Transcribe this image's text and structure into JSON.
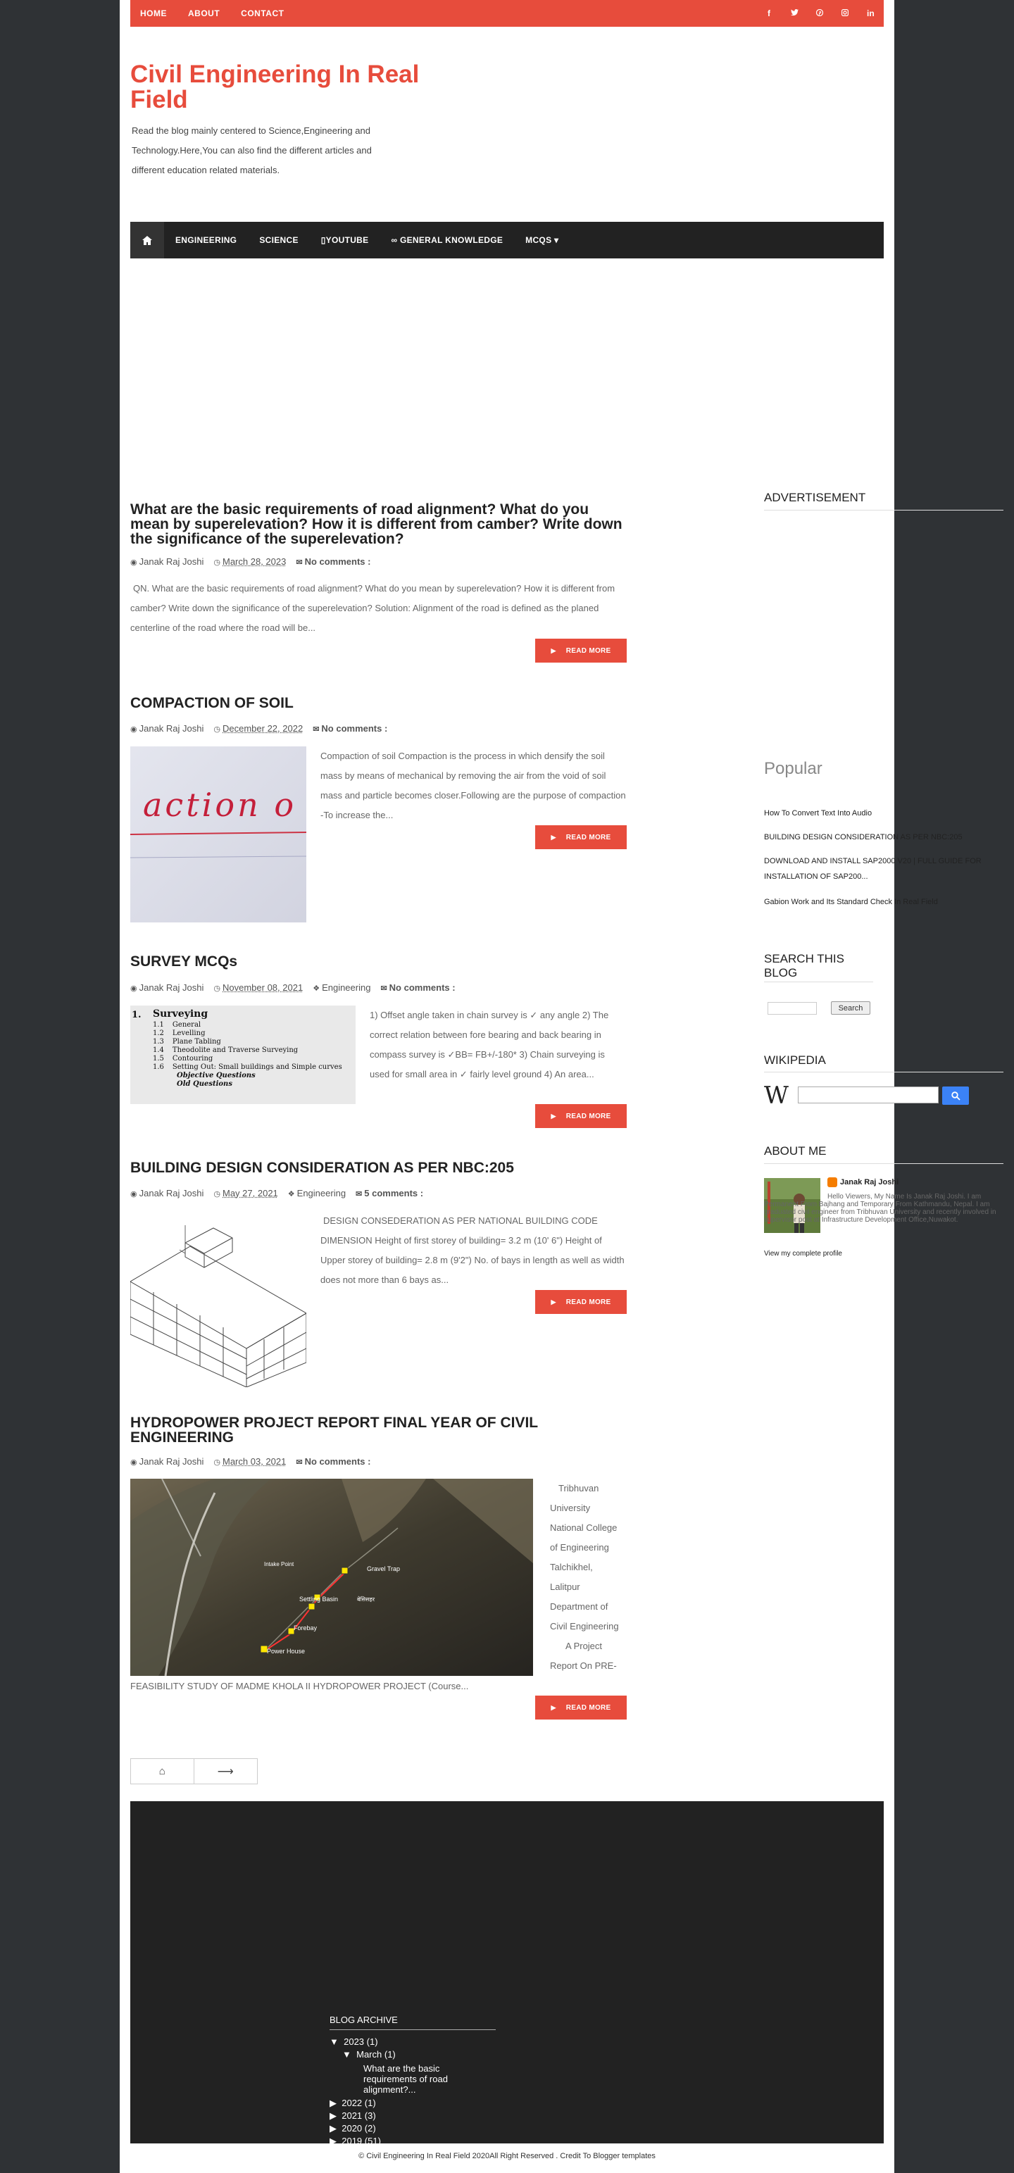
{
  "topnav": {
    "home": "HOME",
    "about": "ABOUT",
    "contact": "CONTACT"
  },
  "social": {
    "facebook": "f",
    "twitter": "t",
    "pinterest": "p",
    "instagram": "i",
    "linkedin": "in"
  },
  "header": {
    "title": "Civil Engineering In Real Field",
    "description": "Read the blog mainly centered to Science,Engineering and Technology.Here,You can also find the different articles and different education related materials."
  },
  "mainnav": {
    "items": [
      "ENGINEERING",
      "SCIENCE",
      "▯YOUTUBE",
      "∞ GENERAL KNOWLEDGE",
      "MCQS ▾"
    ]
  },
  "posts": [
    {
      "title": "What are the basic requirements of road alignment? What do you mean by superelevation? How it is different from camber? Write down the significance of the superelevation?",
      "author": "Janak Raj Joshi",
      "date": "March 28, 2023",
      "label": "",
      "comments": "No comments :",
      "excerpt": "QN. What are the basic requirements of road alignment? What do you mean by superelevation? How it is different from camber? Write down the significance of the superelevation? Solution:              Alignment of the road is defined as the planed centerline of the road where the road will be...",
      "readmore": "READ MORE"
    },
    {
      "title": "COMPACTION OF SOIL",
      "author": "Janak Raj Joshi",
      "date": "December 22, 2022",
      "label": "",
      "comments": "No comments :",
      "excerpt": "Compaction of soil Compaction is the process in which densify the soil mass by means of mechanical by removing the air from the void of soil mass and particle becomes closer.Following are the purpose of compaction -To increase the...",
      "thumb_text": "action o",
      "readmore": "READ MORE"
    },
    {
      "title": "SURVEY MCQs",
      "author": "Janak Raj Joshi",
      "date": "November 08, 2021",
      "label": "Engineering",
      "comments": "No comments :",
      "excerpt": "1) Offset angle taken in chain survey is ✓ any angle 2) The correct relation between fore bearing and back bearing in compass survey is ✓BB= FB+/-180* 3) Chain surveying is used for small area in ✓ fairly level ground 4) An area...",
      "thumb_heading": "Surveying",
      "thumb_num": "1.",
      "thumb_rows": [
        {
          "n": "1.1",
          "t": "General"
        },
        {
          "n": "1.2",
          "t": "Levelling"
        },
        {
          "n": "1.3",
          "t": "Plane Tabling"
        },
        {
          "n": "1.4",
          "t": "Theodolite and Traverse Surveying"
        },
        {
          "n": "1.5",
          "t": "Contouring"
        },
        {
          "n": "1.6",
          "t": "Setting Out: Small buildings and Simple curves"
        }
      ],
      "thumb_obj": "Objective Questions",
      "thumb_old": "Old Questions",
      "readmore": "READ MORE"
    },
    {
      "title": "BUILDING DESIGN CONSIDERATION AS PER NBC:205",
      "author": "Janak Raj Joshi",
      "date": "May 27, 2021",
      "label": "Engineering",
      "comments": "5 comments :",
      "excerpt": "DESIGN CONSEDERATION AS PER NATIONAL BUILDING CODE DIMENSION Height of first storey of building= 3.2 m (10' 6\") Height of Upper storey of building= 2.8 m (9'2\") No. of bays in length as well as width does not more than 6 bays as...",
      "readmore": "READ MORE"
    },
    {
      "title": "HYDROPOWER PROJECT REPORT FINAL YEAR OF CIVIL ENGINEERING",
      "author": "Janak Raj Joshi",
      "date": "March 03, 2021",
      "label": "",
      "comments": "No comments :",
      "excerpt_side": [
        "Tribhuvan",
        "University",
        "National College",
        "of Engineering",
        "Talchikhel,",
        "Lalitpur",
        "Department of",
        "Civil Engineering",
        "A Project",
        "Report On  PRE-"
      ],
      "excerpt_bottom": "FEASIBILITY STUDY OF MADME KHOLA II HYDROPOWER PROJECT   (Course...",
      "map_labels": {
        "intake": "Intake Point",
        "gravel": "Gravel Trap",
        "settling": "Settling Basin",
        "forebay": "Forebay",
        "powerhouse": "Power House",
        "village": "बेसिसहर"
      },
      "readmore": "READ MORE"
    }
  ],
  "pager": {
    "home": "⌂",
    "next": "⟶"
  },
  "sidebar": {
    "advertisement": "ADVERTISEMENT",
    "popular": "Popular",
    "popular_links": [
      "How To Convert Text Into Audio",
      "BUILDING DESIGN CONSIDERATION AS PER NBC:205",
      "DOWNLOAD AND INSTALL SAP2000 V20 | FULL GUIDE FOR INSTALLATION OF SAP200...",
      "Gabion Work and Its Standard Check In Real Field"
    ],
    "search_heading": "SEARCH THIS BLOG",
    "search_button": "Search",
    "wikipedia": "WIKIPEDIA",
    "wiki_logo": "W",
    "about_heading": "ABOUT ME",
    "about_name": "Janak Raj Joshi",
    "about_text": "Hello Viewers, My Name Is Janak Raj Joshi. I am Permanent From Bajhang and Temporary From Kathmandu, Nepal. I am graduated civil engineer from Tribhuvan University and recently involved in supervisor post at Infrastructure Development Office,Nuwakot.",
    "about_profile": "View my complete profile"
  },
  "archive": {
    "heading": "BLOG ARCHIVE",
    "y2023": "2023",
    "y2023_count": "(1)",
    "march": "March",
    "march_count": "(1)",
    "march_post": "What are the basic requirements of road alignment?...",
    "y2022": "2022",
    "y2022_count": "(1)",
    "y2021": "2021",
    "y2021_count": "(3)",
    "y2020": "2020",
    "y2020_count": "(2)",
    "y2019": "2019",
    "y2019_count": "(51)"
  },
  "footer": {
    "copyright": "© Civil Engineering In Real Field 2020All Right Reserved . Credit To Blogger templates"
  },
  "colors": {
    "accent": "#e74c3c",
    "dark": "#222222",
    "background": "#2f3235"
  }
}
